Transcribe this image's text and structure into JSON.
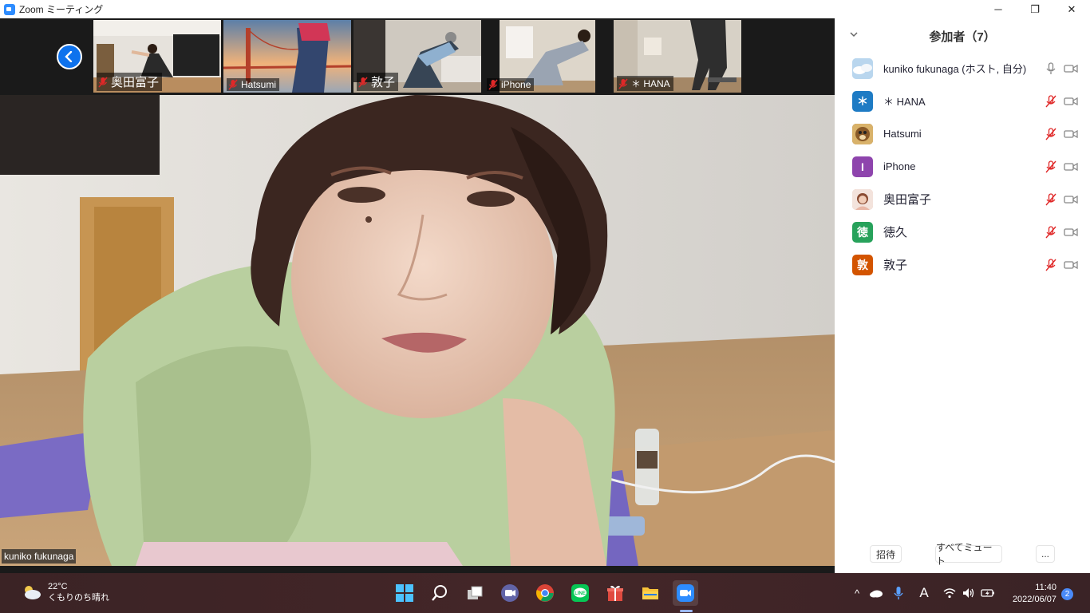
{
  "window": {
    "title": "Zoom ミーティング",
    "controls": {
      "minimize": "─",
      "restore": "❐",
      "close": "✕"
    }
  },
  "thumbnails": [
    {
      "name": "奥田富子",
      "muted": true
    },
    {
      "name": "Hatsumi",
      "muted": true
    },
    {
      "name": "敦子",
      "muted": true
    },
    {
      "name": "iPhone",
      "muted": true
    },
    {
      "name": "＊ HANA",
      "muted": true
    }
  ],
  "main_video": {
    "name": "kuniko fukunaga"
  },
  "participants_panel": {
    "title": "参加者（7）",
    "participants": [
      {
        "name": "kuniko fukunaga (ホスト, 自分)",
        "avatar_text": "",
        "avatar_color": "#b9d6ee",
        "muted": false
      },
      {
        "name": "＊ HANA",
        "avatar_text": "＊",
        "avatar_color": "#1e7bc4",
        "muted": true
      },
      {
        "name": "Hatsumi",
        "avatar_text": "",
        "avatar_color": "#9b6a2d",
        "muted": true
      },
      {
        "name": "iPhone",
        "avatar_text": "I",
        "avatar_color": "#8e44ad",
        "muted": true
      },
      {
        "name": "奥田富子",
        "avatar_text": "",
        "avatar_color": "#e8b7a6",
        "muted": true
      },
      {
        "name": "徳久",
        "avatar_text": "徳",
        "avatar_color": "#27a25b",
        "muted": true
      },
      {
        "name": "敦子",
        "avatar_text": "敦",
        "avatar_color": "#d35400",
        "muted": true
      }
    ],
    "buttons": {
      "invite": "招待",
      "mute_all": "すべてミュート",
      "more": "..."
    }
  },
  "taskbar": {
    "weather": {
      "temp": "22°C",
      "condition": "くもりのち晴れ"
    },
    "apps": [
      "windows-start",
      "search",
      "task-view",
      "teams-chat",
      "chrome",
      "line",
      "gift",
      "file-explorer",
      "zoom"
    ],
    "tray": {
      "chevron": "^",
      "ime": "A"
    },
    "clock": {
      "time": "11:40",
      "date": "2022/06/07"
    },
    "notifications": "2"
  },
  "colors": {
    "accent": "#0e72ed",
    "muted_red": "#e02828",
    "taskbar": "#3f2426"
  }
}
